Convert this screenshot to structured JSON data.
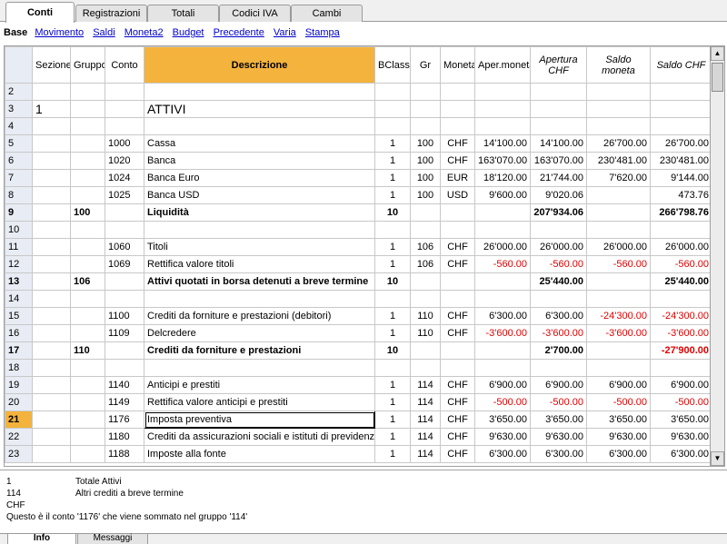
{
  "top_tabs": [
    {
      "label": "Conti",
      "active": true
    },
    {
      "label": "Registrazioni",
      "active": false
    },
    {
      "label": "Totali",
      "active": false
    },
    {
      "label": "Codici IVA",
      "active": false
    },
    {
      "label": "Cambi",
      "active": false
    }
  ],
  "views": [
    {
      "label": "Base",
      "active": true
    },
    {
      "label": "Movimento",
      "active": false
    },
    {
      "label": "Saldi",
      "active": false
    },
    {
      "label": "Moneta2",
      "active": false
    },
    {
      "label": "Budget",
      "active": false
    },
    {
      "label": "Precedente",
      "active": false
    },
    {
      "label": "Varia",
      "active": false
    },
    {
      "label": "Stampa",
      "active": false
    }
  ],
  "columns": [
    "Sezione",
    "Gruppo",
    "Conto",
    "Descrizione",
    "BClasse",
    "Gr",
    "Moneta",
    "Aper.moneta",
    "Apertura CHF",
    "Saldo moneta",
    "Saldo CHF"
  ],
  "rows": [
    {
      "n": "2"
    },
    {
      "n": "3",
      "sezione": "1",
      "descrizione": "ATTIVI",
      "big": true
    },
    {
      "n": "4"
    },
    {
      "n": "5",
      "conto": "1000",
      "descrizione": "Cassa",
      "bclasse": "1",
      "gr": "100",
      "moneta": "CHF",
      "aper": "14'100.00",
      "apchf": "14'100.00",
      "saldom": "26'700.00",
      "saldochf": "26'700.00"
    },
    {
      "n": "6",
      "conto": "1020",
      "descrizione": "Banca",
      "bclasse": "1",
      "gr": "100",
      "moneta": "CHF",
      "aper": "163'070.00",
      "apchf": "163'070.00",
      "saldom": "230'481.00",
      "saldochf": "230'481.00"
    },
    {
      "n": "7",
      "conto": "1024",
      "descrizione": "Banca Euro",
      "bclasse": "1",
      "gr": "100",
      "moneta": "EUR",
      "aper": "18'120.00",
      "apchf": "21'744.00",
      "saldom": "7'620.00",
      "saldochf": "9'144.00"
    },
    {
      "n": "8",
      "conto": "1025",
      "descrizione": "Banca USD",
      "bclasse": "1",
      "gr": "100",
      "moneta": "USD",
      "aper": "9'600.00",
      "apchf": "9'020.06",
      "saldom": "",
      "saldochf": "473.76"
    },
    {
      "n": "9",
      "gruppo": "100",
      "descrizione": "Liquidità",
      "bclasse": "10",
      "apchf": "207'934.06",
      "saldochf": "266'798.76",
      "total": true
    },
    {
      "n": "10"
    },
    {
      "n": "11",
      "conto": "1060",
      "descrizione": "Titoli",
      "bclasse": "1",
      "gr": "106",
      "moneta": "CHF",
      "aper": "26'000.00",
      "apchf": "26'000.00",
      "saldom": "26'000.00",
      "saldochf": "26'000.00"
    },
    {
      "n": "12",
      "conto": "1069",
      "descrizione": "Rettifica valore titoli",
      "bclasse": "1",
      "gr": "106",
      "moneta": "CHF",
      "aper": "-560.00",
      "apchf": "-560.00",
      "saldom": "-560.00",
      "saldochf": "-560.00"
    },
    {
      "n": "13",
      "gruppo": "106",
      "descrizione": "Attivi quotati in borsa detenuti a breve termine",
      "bclasse": "10",
      "apchf": "25'440.00",
      "saldochf": "25'440.00",
      "total": true
    },
    {
      "n": "14"
    },
    {
      "n": "15",
      "conto": "1100",
      "descrizione": "Crediti da forniture e prestazioni (debitori)",
      "bclasse": "1",
      "gr": "110",
      "moneta": "CHF",
      "aper": "6'300.00",
      "apchf": "6'300.00",
      "saldom": "-24'300.00",
      "saldochf": "-24'300.00"
    },
    {
      "n": "16",
      "conto": "1109",
      "descrizione": "Delcredere",
      "bclasse": "1",
      "gr": "110",
      "moneta": "CHF",
      "aper": "-3'600.00",
      "apchf": "-3'600.00",
      "saldom": "-3'600.00",
      "saldochf": "-3'600.00"
    },
    {
      "n": "17",
      "gruppo": "110",
      "descrizione": "Crediti da forniture e prestazioni",
      "bclasse": "10",
      "apchf": "2'700.00",
      "saldochf": "-27'900.00",
      "total": true
    },
    {
      "n": "18"
    },
    {
      "n": "19",
      "conto": "1140",
      "descrizione": "Anticipi e prestiti",
      "bclasse": "1",
      "gr": "114",
      "moneta": "CHF",
      "aper": "6'900.00",
      "apchf": "6'900.00",
      "saldom": "6'900.00",
      "saldochf": "6'900.00"
    },
    {
      "n": "20",
      "conto": "1149",
      "descrizione": "Rettifica valore anticipi e prestiti",
      "bclasse": "1",
      "gr": "114",
      "moneta": "CHF",
      "aper": "-500.00",
      "apchf": "-500.00",
      "saldom": "-500.00",
      "saldochf": "-500.00"
    },
    {
      "n": "21",
      "conto": "1176",
      "descrizione": "Imposta preventiva",
      "bclasse": "1",
      "gr": "114",
      "moneta": "CHF",
      "aper": "3'650.00",
      "apchf": "3'650.00",
      "saldom": "3'650.00",
      "saldochf": "3'650.00",
      "current": true
    },
    {
      "n": "22",
      "conto": "1180",
      "descrizione": "Crediti da assicurazioni sociali e istituti di previdenza",
      "bclasse": "1",
      "gr": "114",
      "moneta": "CHF",
      "aper": "9'630.00",
      "apchf": "9'630.00",
      "saldom": "9'630.00",
      "saldochf": "9'630.00"
    },
    {
      "n": "23",
      "conto": "1188",
      "descrizione": "Imposte alla fonte",
      "bclasse": "1",
      "gr": "114",
      "moneta": "CHF",
      "aper": "6'300.00",
      "apchf": "6'300.00",
      "saldom": "6'300.00",
      "saldochf": "6'300.00"
    }
  ],
  "info": [
    {
      "k": "1",
      "v": "Totale Attivi"
    },
    {
      "k": "114",
      "v": "Altri crediti a breve termine"
    },
    {
      "k": "CHF",
      "v": ""
    },
    {
      "k": "",
      "v": "Questo è il conto '1176' che viene sommato nel gruppo '114'"
    }
  ],
  "bottom_tabs": [
    {
      "label": "Info",
      "active": true
    },
    {
      "label": "Messaggi",
      "active": false
    }
  ],
  "colors": {
    "header_highlight": "#f3b33d",
    "negative": "#e00000",
    "link": "#0000cc"
  }
}
